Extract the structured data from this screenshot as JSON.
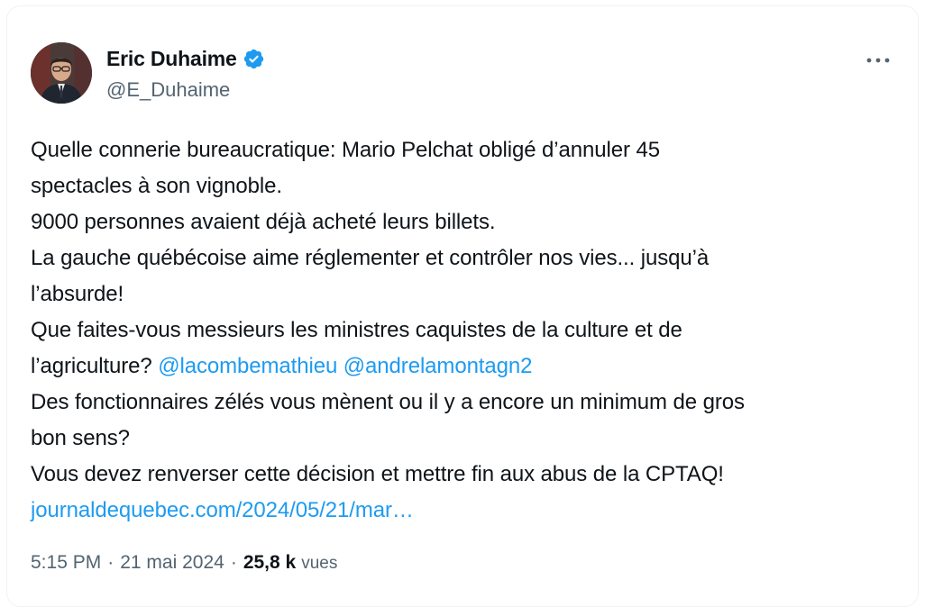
{
  "author": {
    "display_name": "Eric Duhaime",
    "handle": "@E_Duhaime",
    "verified_icon": "verified-badge-icon",
    "verified_color": "#1d9bf0"
  },
  "menu": {
    "icon": "more-horizontal-icon"
  },
  "tweet": {
    "line1": "Quelle connerie bureaucratique: Mario Pelchat obligé d’annuler 45",
    "line2": "spectacles à son vignoble.",
    "line3": "9000 personnes avaient déjà acheté leurs billets.",
    "line4": "La gauche québécoise aime réglementer et contrôler nos vies... jusqu’à",
    "line5": "l’absurde!",
    "line6": "Que faites-vous messieurs les ministres caquistes de la culture et de",
    "line7_text": "l’agriculture? ",
    "mention1": "@lacombemathieu",
    "mention2": "@andrelamontagn2",
    "line8": "Des fonctionnaires zélés vous mènent ou il y a encore un minimum de gros",
    "line9": "bon sens?",
    "line10": "Vous devez renverser cette décision et mettre fin aux abus de la CPTAQ!",
    "link": "journaldequebec.com/2024/05/21/mar…"
  },
  "meta": {
    "time": "5:15 PM",
    "separator": "·",
    "date": "21 mai 2024",
    "views_count": "25,8 k",
    "views_label": "vues"
  },
  "colors": {
    "link": "#1d9bf0",
    "text": "#0f1419",
    "secondary": "#536471"
  }
}
